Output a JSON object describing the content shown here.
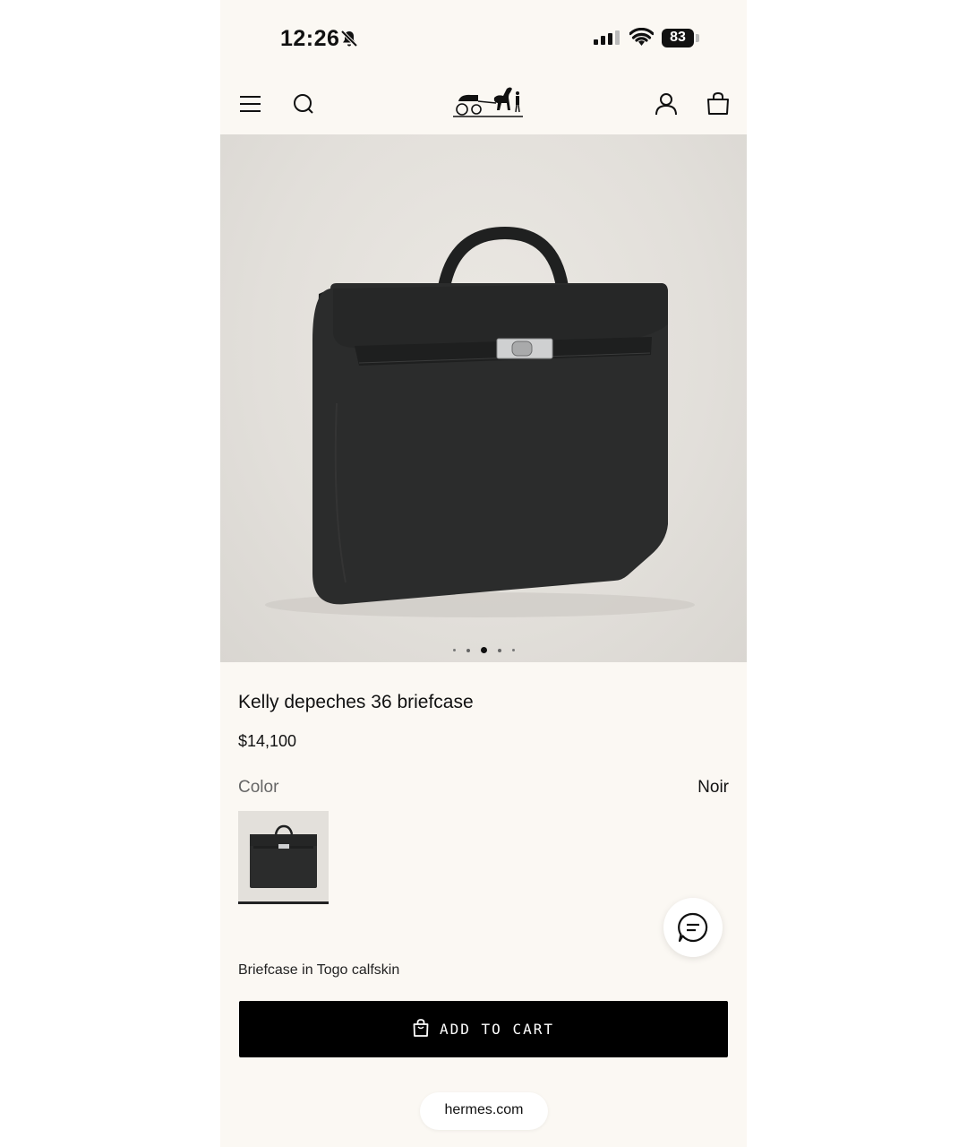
{
  "status_bar": {
    "time": "12:26",
    "battery": "83",
    "icons": [
      "bell-slash-icon",
      "signal-icon",
      "wifi-icon",
      "battery-icon"
    ]
  },
  "header": {
    "icons": [
      "menu-icon",
      "search-icon",
      "logo-horse-carriage",
      "account-icon",
      "shopping-bag-icon"
    ]
  },
  "gallery": {
    "image_count": 5,
    "active_index": 3
  },
  "product": {
    "name": "Kelly depeches 36 briefcase",
    "price": "$14,100",
    "color_label": "Color",
    "color_value": "Noir",
    "description": "Briefcase in Togo calfskin",
    "add_to_cart_label": "ADD TO CART"
  },
  "footer": {
    "url": "hermes.com"
  },
  "colors": {
    "page_background": "#fbf8f3",
    "button_background": "#000000",
    "bag_color": "#2b2c2c"
  }
}
